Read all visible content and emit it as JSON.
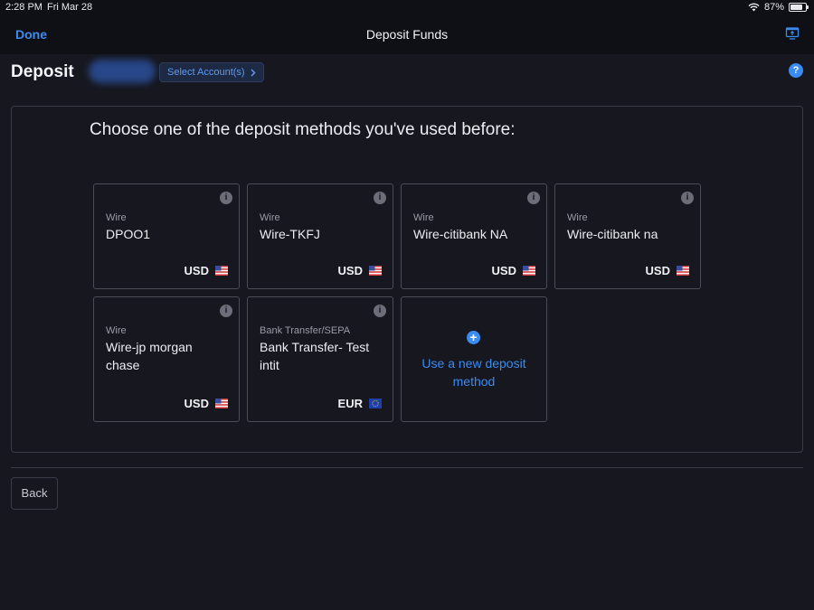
{
  "status_bar": {
    "time": "2:28 PM",
    "date": "Fri Mar 28",
    "battery": "87%"
  },
  "nav": {
    "done_label": "Done",
    "title": "Deposit Funds"
  },
  "header": {
    "heading": "Deposit",
    "select_accounts_label": "Select Account(s)",
    "help_glyph": "?"
  },
  "main": {
    "prompt": "Choose one of the deposit methods you've used before:",
    "methods": [
      {
        "type": "Wire",
        "name": "DPOO1",
        "currency": "USD",
        "flag": "us-flag-icon"
      },
      {
        "type": "Wire",
        "name": "Wire-TKFJ",
        "currency": "USD",
        "flag": "us-flag-icon"
      },
      {
        "type": "Wire",
        "name": "Wire-citibank NA",
        "currency": "USD",
        "flag": "us-flag-icon"
      },
      {
        "type": "Wire",
        "name": "Wire-citibank na",
        "currency": "USD",
        "flag": "us-flag-icon"
      },
      {
        "type": "Wire",
        "name": "Wire-jp morgan chase",
        "currency": "USD",
        "flag": "us-flag-icon"
      },
      {
        "type": "Bank Transfer/SEPA",
        "name": "Bank Transfer- Test intit",
        "currency": "EUR",
        "flag": "eu-flag-icon"
      }
    ],
    "new_method_label": "Use a new deposit method",
    "info_glyph": "i",
    "plus_glyph": "+"
  },
  "footer": {
    "back_label": "Back"
  },
  "colors": {
    "accent": "#3b8bf0",
    "background": "#16171f",
    "card_border": "#4a4c58"
  }
}
